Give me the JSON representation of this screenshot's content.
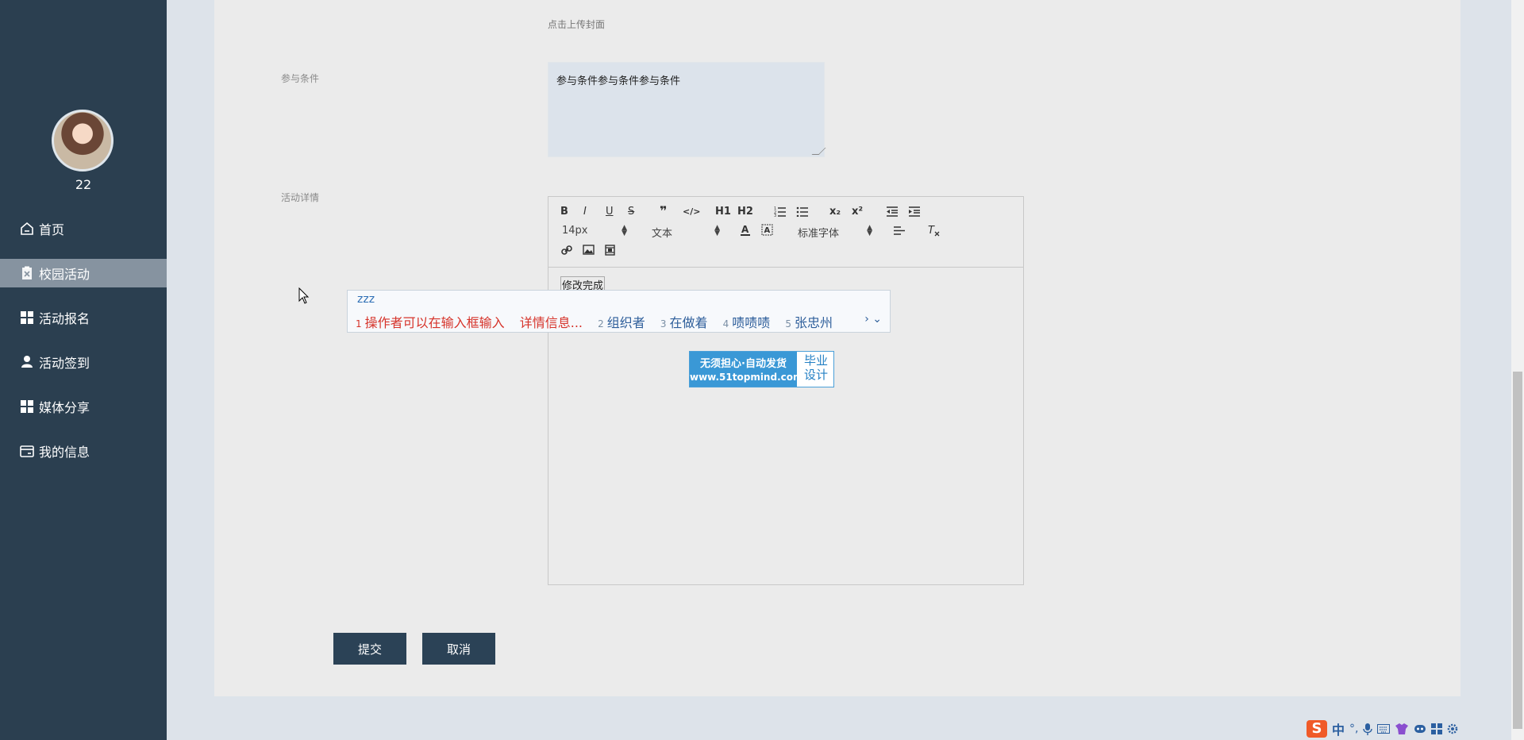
{
  "sidebar": {
    "username": "22",
    "items": [
      {
        "label": "首页",
        "icon": "home-icon"
      },
      {
        "label": "校园活动",
        "icon": "clipboard-icon",
        "active": true
      },
      {
        "label": "活动报名",
        "icon": "grid-icon"
      },
      {
        "label": "活动签到",
        "icon": "user-icon"
      },
      {
        "label": "媒体分享",
        "icon": "grid-icon"
      },
      {
        "label": "我的信息",
        "icon": "card-icon"
      }
    ]
  },
  "form": {
    "upload_hint": "点击上传封面",
    "condition_label": "参与条件",
    "condition_value": "参与条件参与条件参与条件",
    "detail_label": "活动详情",
    "editor": {
      "bold": "B",
      "italic": "I",
      "underline": "U",
      "strike": "S",
      "quote": "❞",
      "code": "</>",
      "h1": "H1",
      "h2": "H2",
      "subscript": "x₂",
      "superscript": "x²",
      "font_size": "14px",
      "block_type": "文本",
      "font_family": "标准字体",
      "content": "修改完成"
    },
    "submit_label": "提交",
    "cancel_label": "取消"
  },
  "ime": {
    "input": "zzz",
    "candidates": [
      {
        "num": "1",
        "text": "操作者可以在输入框输入"
      },
      {
        "num": "",
        "text": "详情信息..."
      },
      {
        "num": "2",
        "text": "组织者"
      },
      {
        "num": "3",
        "text": "在做着"
      },
      {
        "num": "4",
        "text": "啧啧啧"
      },
      {
        "num": "5",
        "text": "张忠州"
      }
    ],
    "nav": "› ⌄"
  },
  "ad": {
    "line1": "无须担心·自动发货",
    "line2": "www.51topmind.com",
    "right1": "毕业",
    "right2": "设计"
  },
  "tray": {
    "sogou": "S",
    "lang": "中"
  },
  "colors": {
    "sidebar_bg": "#2b3f50",
    "active_item_bg": "#8693a0",
    "button_bg": "#2b4256",
    "page_bg": "#dde3ea",
    "card_bg": "#ebebeb"
  }
}
